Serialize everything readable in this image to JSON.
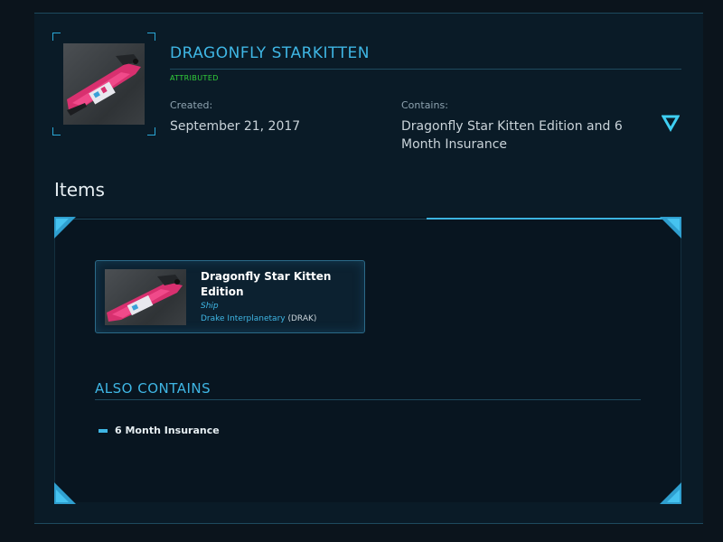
{
  "pledge": {
    "title": "DRAGONFLY STARKITTEN",
    "status": "ATTRIBUTED",
    "created_label": "Created:",
    "created_value": "September 21, 2017",
    "contains_label": "Contains:",
    "contains_line1": "Dragonfly Star Kitten Edition and 6",
    "contains_line2": "Month Insurance",
    "expand_icon": "triangle-down-icon"
  },
  "items_section": {
    "heading": "Items",
    "cards": [
      {
        "name_line1": "Dragonfly Star Kitten",
        "name_line2": "Edition",
        "type": "Ship",
        "manufacturer": "Drake Interplanetary",
        "manufacturer_code": "(DRAK)"
      }
    ]
  },
  "also_contains": {
    "heading": "ALSO CONTAINS",
    "items": [
      "6 Month Insurance"
    ]
  },
  "colors": {
    "accent": "#3fb6e4",
    "status_green": "#33d13a",
    "background": "#0a1b27",
    "ship_pink": "#e0337a"
  }
}
